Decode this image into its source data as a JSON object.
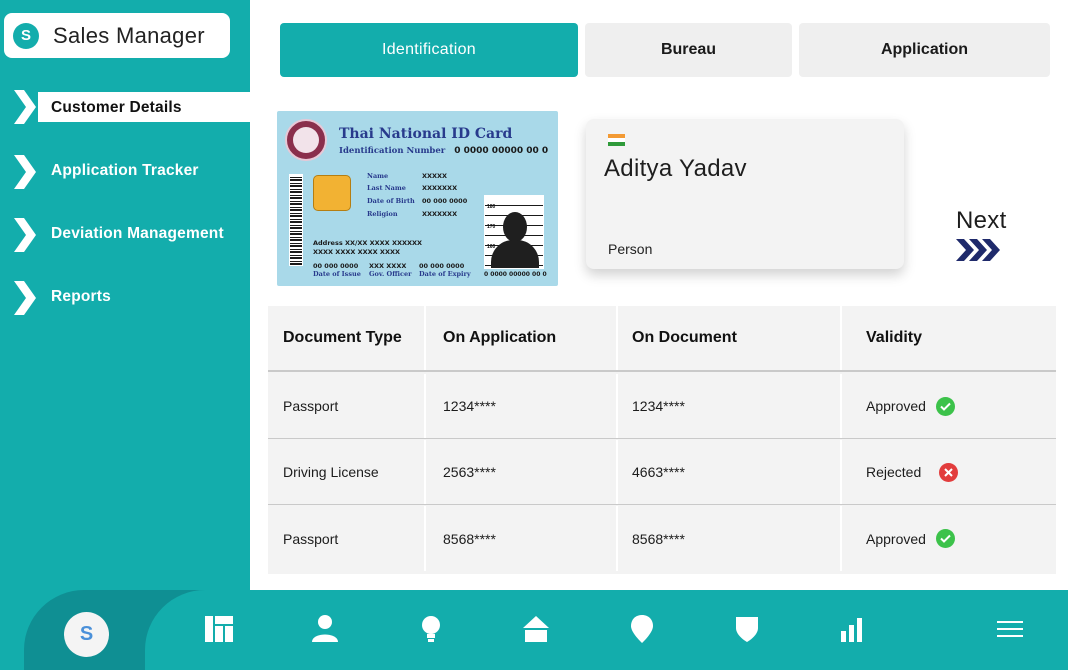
{
  "sidebar": {
    "brand_badge": "S",
    "brand_title": "Sales Manager",
    "items": [
      {
        "label": "Customer Details",
        "active": true
      },
      {
        "label": "Application Tracker",
        "active": false
      },
      {
        "label": "Deviation Management",
        "active": false
      },
      {
        "label": "Reports",
        "active": false
      }
    ]
  },
  "tabs": [
    {
      "label": "Identification",
      "active": true
    },
    {
      "label": "Bureau",
      "active": false
    },
    {
      "label": "Application",
      "active": false
    }
  ],
  "id_card": {
    "title": "Thai National ID Card",
    "id_number_label": "Identification Number",
    "id_number": "0 0000 00000 00 0",
    "fields": [
      {
        "label": "Name",
        "value": "XXXXX"
      },
      {
        "label": "Last Name",
        "value": "XXXXXXX"
      },
      {
        "label": "Date of Birth",
        "value": "00 000 0000"
      },
      {
        "label": "Religion",
        "value": "XXXXXXX"
      }
    ],
    "address_line1": "Address XX/XX XXXX XXXXXX",
    "address_line2": "XXXX XXXX XXXX XXXX",
    "footer": [
      {
        "value": "00 000 0000",
        "label": "Date of Issue"
      },
      {
        "value": "XXX XXXX",
        "label": "Gov. Officer"
      },
      {
        "value": "00 000 0000",
        "label": "Date of Expiry"
      }
    ],
    "photo_number": "0 0000 00000 00 0",
    "height_marks": [
      "180",
      "170",
      "160"
    ]
  },
  "profile": {
    "name": "Aditya Yadav",
    "type": "Person",
    "flag_colors": [
      "#f39a34",
      "#ffffff",
      "#2f9a3a"
    ]
  },
  "next": {
    "label": "Next",
    "icon": "triple-chevron-right-icon"
  },
  "documents": {
    "headers": [
      "Document Type",
      "On Application",
      "On Document",
      "Validity"
    ],
    "rows": [
      {
        "type": "Passport",
        "on_application": "1234****",
        "on_document": "1234****",
        "validity": "Approved",
        "status": "approved"
      },
      {
        "type": "Driving License",
        "on_application": "2563****",
        "on_document": "4663****",
        "validity": "Rejected",
        "status": "rejected"
      },
      {
        "type": "Passport",
        "on_application": "8568****",
        "on_document": "8568****",
        "validity": "Approved",
        "status": "approved"
      }
    ]
  },
  "bottom_nav": {
    "avatar": "S",
    "icons": [
      "dashboard-icon",
      "user-icon",
      "bulb-icon",
      "home-icon",
      "location-icon",
      "shield-icon",
      "bar-chart-icon",
      "menu-icon"
    ]
  },
  "colors": {
    "teal": "#13adac",
    "teal_dark": "#0f8f93",
    "approved": "#3cc24a",
    "rejected": "#e23c3c",
    "navy": "#1f2a6b"
  }
}
